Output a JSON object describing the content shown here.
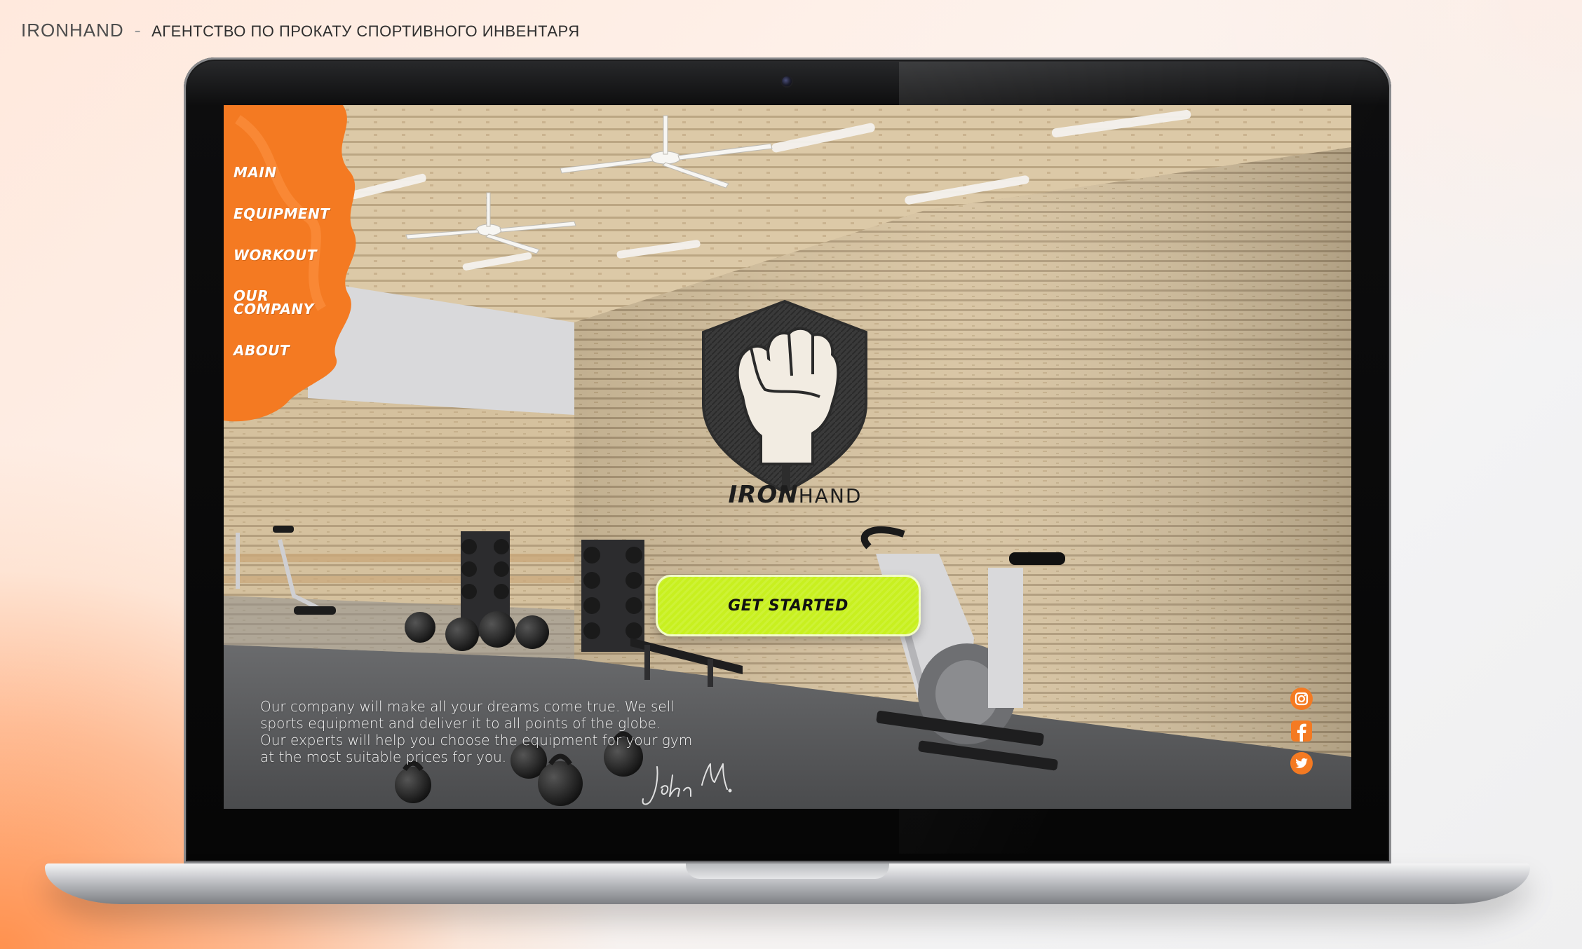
{
  "page_heading": {
    "brand": "IRONHAND",
    "separator": "-",
    "tagline": "АГЕНТСТВО ПО ПРОКАТУ СПОРТИВНОГО ИНВЕНТАРЯ"
  },
  "site": {
    "nav": [
      {
        "label": "MAIN"
      },
      {
        "label": "EQUIPMENT"
      },
      {
        "label": "WORKOUT"
      },
      {
        "label": "OUR COMPANY"
      },
      {
        "label": "ABOUT"
      }
    ],
    "logo": {
      "iron": "IRON",
      "hand": "HAND"
    },
    "cta_label": "GET STARTED",
    "intro_lines": [
      "Our company will make all your dreams come true. We sell",
      "sports equipment and deliver it to all points of the globe.",
      "Our experts will help you choose the equipment for your gym",
      "at the most suitable prices for you."
    ],
    "signature": "John M.",
    "social": [
      {
        "icon": "instagram-icon"
      },
      {
        "icon": "facebook-icon"
      },
      {
        "icon": "twitter-icon"
      }
    ]
  },
  "colors": {
    "accent_orange": "#f47a22",
    "cta_lime": "#c8f01f",
    "floor_gray": "#5b5c5e",
    "wood": "#d5c09d"
  }
}
